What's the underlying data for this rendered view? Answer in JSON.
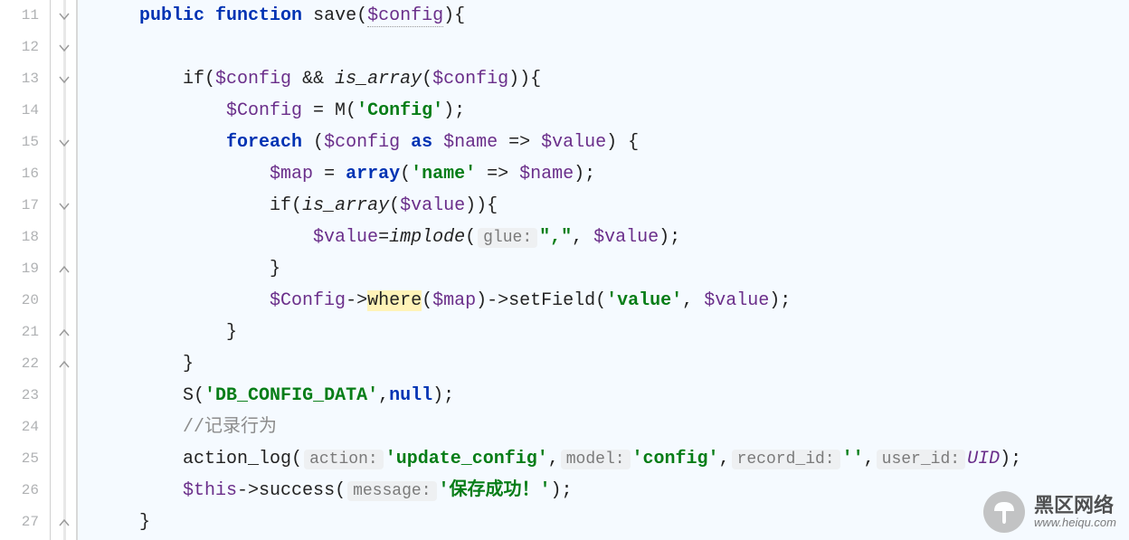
{
  "gutter": {
    "start": 11,
    "end": 27
  },
  "fold": {
    "open_rows": [
      0,
      1,
      2,
      4,
      6,
      8,
      10,
      11
    ],
    "close_rows": [
      16
    ]
  },
  "code": {
    "l11": {
      "kw1": "public",
      "kw2": "function",
      "fn": "save",
      "var": "$config",
      "tail": "){"
    },
    "l13": {
      "pre": "if(",
      "v1": "$config",
      "amp": " && ",
      "fn": "is_array",
      "v2": "$config",
      "tail": ")){"
    },
    "l14": {
      "v": "$Config",
      "eq": " = M(",
      "s": "'Config'",
      "tail": ");"
    },
    "l15": {
      "kw": "foreach",
      "lp": " (",
      "v1": "$config",
      "as": " as ",
      "v2": "$name",
      "arr": " => ",
      "v3": "$value",
      "rp": ") {"
    },
    "l16": {
      "v": "$map",
      "eq": " = ",
      "fn": "array",
      "lp": "(",
      "s": "'name'",
      "arr": " => ",
      "v2": "$name",
      "tail": ");"
    },
    "l17": {
      "pre": "if(",
      "fn": "is_array",
      "v": "$value",
      "tail": ")){"
    },
    "l18": {
      "v": "$value",
      "eq": "=",
      "fn": "implode",
      "lp": "(",
      "hint": "glue:",
      "s": "\",\"",
      "c": ", ",
      "v2": "$value",
      "tail": ");"
    },
    "l19": {
      "brace": "}"
    },
    "l20": {
      "v": "$Config",
      "arrow": "->",
      "where": "where",
      "lp": "(",
      "v2": "$map",
      "rp": ")->setField(",
      "s": "'value'",
      "c": ", ",
      "v3": "$value",
      "tail": ");"
    },
    "l21": {
      "brace": "}"
    },
    "l22": {
      "brace": "}"
    },
    "l23": {
      "fn": "S(",
      "s": "'DB_CONFIG_DATA'",
      "c": ",",
      "kw": "null",
      "tail": ");"
    },
    "l24": {
      "cmt": "//记录行为"
    },
    "l25": {
      "fn": "action_log(",
      "h1": "action:",
      "s1": "'update_config'",
      "c1": ",",
      "h2": "model:",
      "s2": "'config'",
      "c2": ",",
      "h3": "record_id:",
      "s3": "''",
      "c3": ",",
      "h4": "user_id:",
      "uid": "UID",
      "tail": ");"
    },
    "l26": {
      "v": "$this",
      "arrow": "->success(",
      "h": "message:",
      "s": "'保存成功！'",
      "tail": ");"
    },
    "l27": {
      "brace": "}"
    }
  },
  "watermark": {
    "big": "黑区网络",
    "small": "www.heiqu.com"
  }
}
